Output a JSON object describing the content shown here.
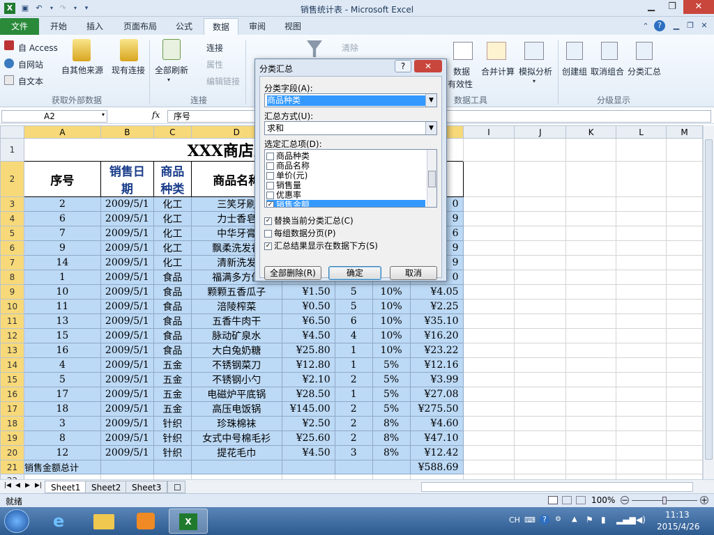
{
  "window": {
    "title": "销售统计表 - Microsoft Excel"
  },
  "tabs": [
    "文件",
    "开始",
    "插入",
    "页面布局",
    "公式",
    "数据",
    "审阅",
    "视图"
  ],
  "ribbon": {
    "access": "自 Access",
    "web": "自网站",
    "text": "自文本",
    "other_sources": "自其他来源",
    "existing": "现有连接",
    "refresh_all": "全部刷新",
    "connections": "连接",
    "properties": "属性",
    "edit_links": "编辑链接",
    "clear": "清除",
    "data_validation": "数据",
    "validity": "有效性",
    "consolidate": "合并计算",
    "whatif": "模拟分析",
    "group": "创建组",
    "ungroup": "取消组合",
    "subtotal": "分类汇总",
    "grp_external": "获取外部数据",
    "grp_connections": "连接",
    "grp_tools": "数据工具",
    "grp_outline": "分级显示"
  },
  "formula_bar": {
    "name_box": "A2",
    "fx": "fx",
    "content": "序号"
  },
  "columns": [
    "A",
    "B",
    "C",
    "D",
    "E",
    "F",
    "G",
    "H",
    "I",
    "J",
    "K",
    "L",
    "M"
  ],
  "sheet": {
    "title": "XXX商店五月份",
    "headers": [
      "序号",
      "销售日期",
      "商品种类",
      "商品名称"
    ],
    "header_lines": [
      [
        "序号"
      ],
      [
        "销售日",
        "期"
      ],
      [
        "商品",
        "种类"
      ],
      [
        "商品名称"
      ]
    ],
    "rows": [
      [
        "2",
        "2009/5/1",
        "化工",
        "三笑牙刷",
        "",
        "",
        "",
        "0"
      ],
      [
        "6",
        "2009/5/1",
        "化工",
        "力士香皂",
        "",
        "",
        "",
        "9"
      ],
      [
        "7",
        "2009/5/1",
        "化工",
        "中华牙膏",
        "",
        "",
        "",
        "6"
      ],
      [
        "9",
        "2009/5/1",
        "化工",
        "飘柔洗发香",
        "",
        "",
        "",
        "9"
      ],
      [
        "14",
        "2009/5/1",
        "化工",
        "清新洗发",
        "",
        "",
        "",
        "9"
      ],
      [
        "1",
        "2009/5/1",
        "食品",
        "福满多方便",
        "",
        "",
        "",
        "0"
      ],
      [
        "10",
        "2009/5/1",
        "食品",
        "颗颗五香瓜子",
        "¥1.50",
        "5",
        "10%",
        "¥4.05"
      ],
      [
        "11",
        "2009/5/1",
        "食品",
        "涪陵榨菜",
        "¥0.50",
        "5",
        "10%",
        "¥2.25"
      ],
      [
        "13",
        "2009/5/1",
        "食品",
        "五香牛肉干",
        "¥6.50",
        "6",
        "10%",
        "¥35.10"
      ],
      [
        "15",
        "2009/5/1",
        "食品",
        "脉动矿泉水",
        "¥4.50",
        "4",
        "10%",
        "¥16.20"
      ],
      [
        "16",
        "2009/5/1",
        "食品",
        "大白兔奶糖",
        "¥25.80",
        "1",
        "10%",
        "¥23.22"
      ],
      [
        "4",
        "2009/5/1",
        "五金",
        "不锈钢菜刀",
        "¥12.80",
        "1",
        "5%",
        "¥12.16"
      ],
      [
        "5",
        "2009/5/1",
        "五金",
        "不锈钢小勺",
        "¥2.10",
        "2",
        "5%",
        "¥3.99"
      ],
      [
        "17",
        "2009/5/1",
        "五金",
        "电磁炉平底锅",
        "¥28.50",
        "1",
        "5%",
        "¥27.08"
      ],
      [
        "18",
        "2009/5/1",
        "五金",
        "高压电饭锅",
        "¥145.00",
        "2",
        "5%",
        "¥275.50"
      ],
      [
        "3",
        "2009/5/1",
        "针织",
        "珍珠棉袜",
        "¥2.50",
        "2",
        "8%",
        "¥4.60"
      ],
      [
        "8",
        "2009/5/1",
        "针织",
        "女式中号棉毛衫",
        "¥25.60",
        "2",
        "8%",
        "¥47.10"
      ],
      [
        "12",
        "2009/5/1",
        "针织",
        "提花毛巾",
        "¥4.50",
        "3",
        "8%",
        "¥12.42"
      ]
    ],
    "total_label": "销售金额总计",
    "total_value": "¥588.69"
  },
  "sheet_tabs": [
    "Sheet1",
    "Sheet2",
    "Sheet3"
  ],
  "status": {
    "ready": "就绪",
    "zoom": "100%"
  },
  "dialog": {
    "title": "分类汇总",
    "help": "?",
    "field_label": "分类字段(A):",
    "field_value": "商品种类",
    "method_label": "汇总方式(U):",
    "method_value": "求和",
    "items_label": "选定汇总项(D):",
    "items": [
      "商品种类",
      "商品名称",
      "单价(元)",
      "销售量",
      "优惠率",
      "销售金额"
    ],
    "items_checked": [
      false,
      false,
      false,
      false,
      false,
      true
    ],
    "opt1": "替换当前分类汇总(C)",
    "opt2": "每组数据分页(P)",
    "opt3": "汇总结果显示在数据下方(S)",
    "opt_checked": [
      true,
      false,
      true
    ],
    "btn_remove": "全部删除(R)",
    "btn_ok": "确定",
    "btn_cancel": "取消"
  },
  "taskbar": {
    "ime": "CH",
    "time": "11:13",
    "date": "2015/4/26"
  }
}
